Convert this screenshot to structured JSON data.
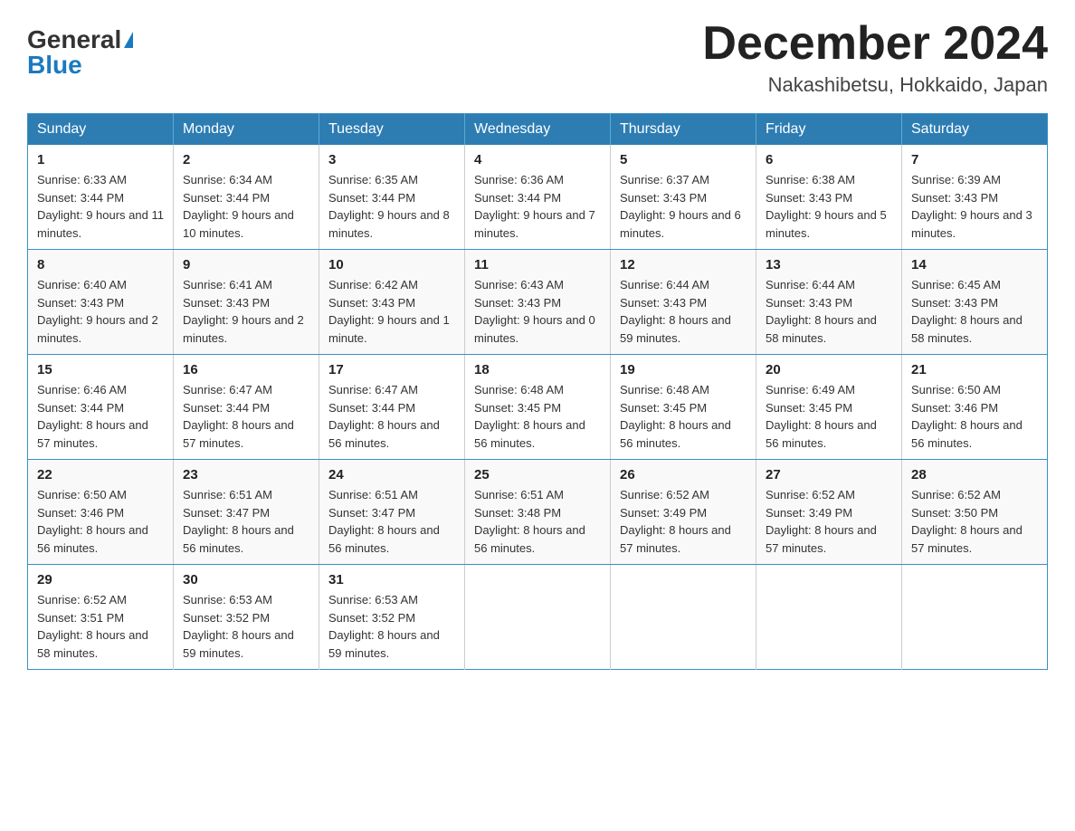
{
  "header": {
    "logo_general": "General",
    "logo_blue": "Blue",
    "month_title": "December 2024",
    "location": "Nakashibetsu, Hokkaido, Japan"
  },
  "weekdays": [
    "Sunday",
    "Monday",
    "Tuesday",
    "Wednesday",
    "Thursday",
    "Friday",
    "Saturday"
  ],
  "weeks": [
    [
      {
        "day": "1",
        "sunrise": "6:33 AM",
        "sunset": "3:44 PM",
        "daylight": "9 hours and 11 minutes."
      },
      {
        "day": "2",
        "sunrise": "6:34 AM",
        "sunset": "3:44 PM",
        "daylight": "9 hours and 10 minutes."
      },
      {
        "day": "3",
        "sunrise": "6:35 AM",
        "sunset": "3:44 PM",
        "daylight": "9 hours and 8 minutes."
      },
      {
        "day": "4",
        "sunrise": "6:36 AM",
        "sunset": "3:44 PM",
        "daylight": "9 hours and 7 minutes."
      },
      {
        "day": "5",
        "sunrise": "6:37 AM",
        "sunset": "3:43 PM",
        "daylight": "9 hours and 6 minutes."
      },
      {
        "day": "6",
        "sunrise": "6:38 AM",
        "sunset": "3:43 PM",
        "daylight": "9 hours and 5 minutes."
      },
      {
        "day": "7",
        "sunrise": "6:39 AM",
        "sunset": "3:43 PM",
        "daylight": "9 hours and 3 minutes."
      }
    ],
    [
      {
        "day": "8",
        "sunrise": "6:40 AM",
        "sunset": "3:43 PM",
        "daylight": "9 hours and 2 minutes."
      },
      {
        "day": "9",
        "sunrise": "6:41 AM",
        "sunset": "3:43 PM",
        "daylight": "9 hours and 2 minutes."
      },
      {
        "day": "10",
        "sunrise": "6:42 AM",
        "sunset": "3:43 PM",
        "daylight": "9 hours and 1 minute."
      },
      {
        "day": "11",
        "sunrise": "6:43 AM",
        "sunset": "3:43 PM",
        "daylight": "9 hours and 0 minutes."
      },
      {
        "day": "12",
        "sunrise": "6:44 AM",
        "sunset": "3:43 PM",
        "daylight": "8 hours and 59 minutes."
      },
      {
        "day": "13",
        "sunrise": "6:44 AM",
        "sunset": "3:43 PM",
        "daylight": "8 hours and 58 minutes."
      },
      {
        "day": "14",
        "sunrise": "6:45 AM",
        "sunset": "3:43 PM",
        "daylight": "8 hours and 58 minutes."
      }
    ],
    [
      {
        "day": "15",
        "sunrise": "6:46 AM",
        "sunset": "3:44 PM",
        "daylight": "8 hours and 57 minutes."
      },
      {
        "day": "16",
        "sunrise": "6:47 AM",
        "sunset": "3:44 PM",
        "daylight": "8 hours and 57 minutes."
      },
      {
        "day": "17",
        "sunrise": "6:47 AM",
        "sunset": "3:44 PM",
        "daylight": "8 hours and 56 minutes."
      },
      {
        "day": "18",
        "sunrise": "6:48 AM",
        "sunset": "3:45 PM",
        "daylight": "8 hours and 56 minutes."
      },
      {
        "day": "19",
        "sunrise": "6:48 AM",
        "sunset": "3:45 PM",
        "daylight": "8 hours and 56 minutes."
      },
      {
        "day": "20",
        "sunrise": "6:49 AM",
        "sunset": "3:45 PM",
        "daylight": "8 hours and 56 minutes."
      },
      {
        "day": "21",
        "sunrise": "6:50 AM",
        "sunset": "3:46 PM",
        "daylight": "8 hours and 56 minutes."
      }
    ],
    [
      {
        "day": "22",
        "sunrise": "6:50 AM",
        "sunset": "3:46 PM",
        "daylight": "8 hours and 56 minutes."
      },
      {
        "day": "23",
        "sunrise": "6:51 AM",
        "sunset": "3:47 PM",
        "daylight": "8 hours and 56 minutes."
      },
      {
        "day": "24",
        "sunrise": "6:51 AM",
        "sunset": "3:47 PM",
        "daylight": "8 hours and 56 minutes."
      },
      {
        "day": "25",
        "sunrise": "6:51 AM",
        "sunset": "3:48 PM",
        "daylight": "8 hours and 56 minutes."
      },
      {
        "day": "26",
        "sunrise": "6:52 AM",
        "sunset": "3:49 PM",
        "daylight": "8 hours and 57 minutes."
      },
      {
        "day": "27",
        "sunrise": "6:52 AM",
        "sunset": "3:49 PM",
        "daylight": "8 hours and 57 minutes."
      },
      {
        "day": "28",
        "sunrise": "6:52 AM",
        "sunset": "3:50 PM",
        "daylight": "8 hours and 57 minutes."
      }
    ],
    [
      {
        "day": "29",
        "sunrise": "6:52 AM",
        "sunset": "3:51 PM",
        "daylight": "8 hours and 58 minutes."
      },
      {
        "day": "30",
        "sunrise": "6:53 AM",
        "sunset": "3:52 PM",
        "daylight": "8 hours and 59 minutes."
      },
      {
        "day": "31",
        "sunrise": "6:53 AM",
        "sunset": "3:52 PM",
        "daylight": "8 hours and 59 minutes."
      },
      null,
      null,
      null,
      null
    ]
  ]
}
